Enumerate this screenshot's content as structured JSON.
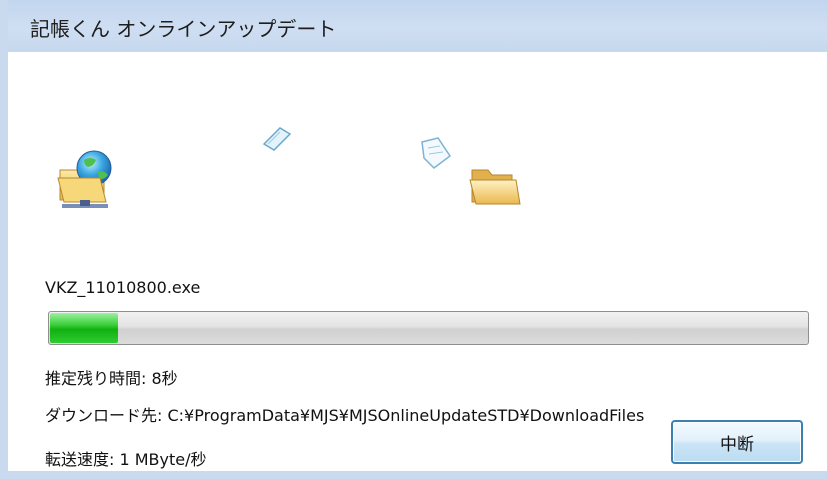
{
  "window": {
    "title": "記帳くん オンラインアップデート"
  },
  "file": {
    "name": "VKZ_11010800.exe"
  },
  "progress": {
    "fraction": 0.09
  },
  "info": {
    "remaining_time": "推定残り時間: 8秒",
    "destination": "ダウンロード先: C:¥ProgramData¥MJS¥MJSOnlineUpdateSTD¥DownloadFiles",
    "speed": "転送速度: 1 MByte/秒"
  },
  "buttons": {
    "cancel_label": "中断"
  },
  "icons": {
    "source": "globe-folder-icon",
    "flying_document_1": "paper-icon",
    "flying_document_2": "paper-icon",
    "destination": "folder-icon"
  },
  "colors": {
    "progress_green": "#22c022",
    "titlebar": "#c9d9ee",
    "button_border": "#3c7fb1"
  }
}
